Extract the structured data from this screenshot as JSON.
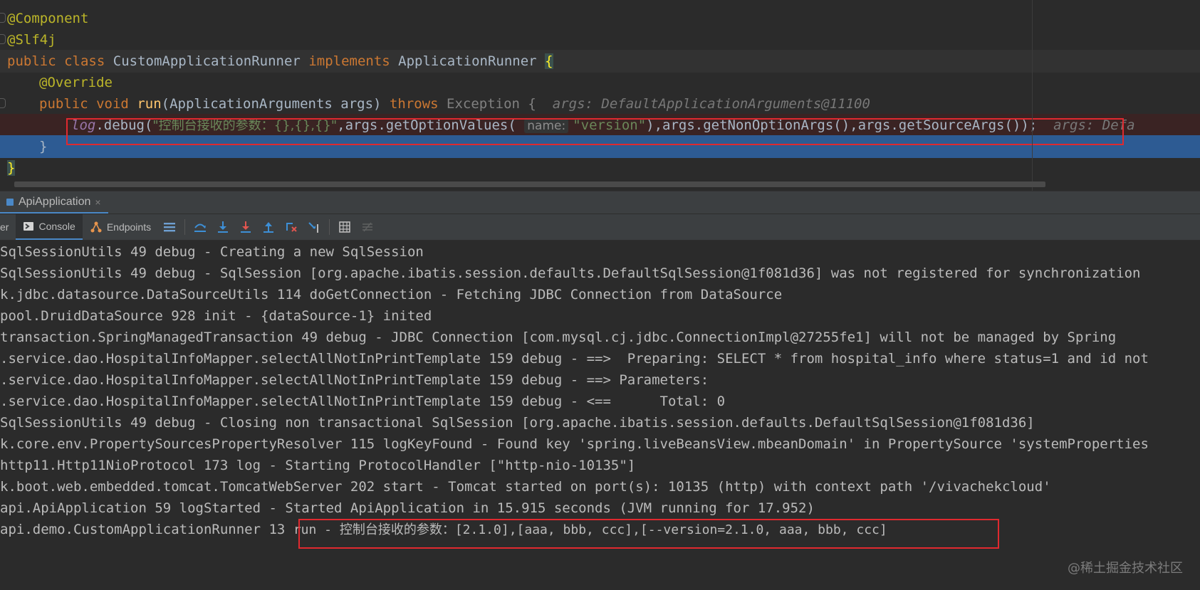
{
  "editor": {
    "line1": {
      "annotation": "@Component"
    },
    "line2": {
      "annotation": "@Slf4j"
    },
    "line3": {
      "kw_public": "public",
      "kw_class": "class",
      "class_name": "CustomApplicationRunner",
      "kw_implements": "implements",
      "interface_name": "ApplicationRunner",
      "brace": "{"
    },
    "line4": {
      "annotation": "@Override"
    },
    "line5": {
      "kw_public": "public",
      "kw_void": "void",
      "method": "run",
      "params": "(ApplicationArguments args)",
      "kw_throws": "throws",
      "exception": "Exception {",
      "hint": "args: DefaultApplicationArguments@11100"
    },
    "line6": {
      "field": "log",
      "call": ".debug(",
      "string": "\"控制台接收的参数：{},{},{}\"",
      "part1": ",args.getOptionValues(",
      "param_hint": "name:",
      "arg": "\"version\"",
      "part2": "),args.getNonOptionArgs(),args.getSourceArgs());",
      "hint": "args: Defa"
    },
    "line7": {
      "brace": "}"
    },
    "line8": {
      "brace": "}"
    }
  },
  "run_panel": {
    "tab_title": "ApiApplication",
    "tab_close": "×",
    "toolbar": {
      "truncated_tab": "er",
      "console_label": "Console",
      "endpoints_label": "Endpoints"
    }
  },
  "console": {
    "lines": [
      "SqlSessionUtils 49 debug - Creating a new SqlSession",
      "SqlSessionUtils 49 debug - SqlSession [org.apache.ibatis.session.defaults.DefaultSqlSession@1f081d36] was not registered for synchronization",
      "k.jdbc.datasource.DataSourceUtils 114 doGetConnection - Fetching JDBC Connection from DataSource",
      "pool.DruidDataSource 928 init - {dataSource-1} inited",
      "transaction.SpringManagedTransaction 49 debug - JDBC Connection [com.mysql.cj.jdbc.ConnectionImpl@27255fe1] will not be managed by Spring",
      ".service.dao.HospitalInfoMapper.selectAllNotInPrintTemplate 159 debug - ==>  Preparing: SELECT * from hospital_info where status=1 and id not",
      ".service.dao.HospitalInfoMapper.selectAllNotInPrintTemplate 159 debug - ==> Parameters: ",
      ".service.dao.HospitalInfoMapper.selectAllNotInPrintTemplate 159 debug - <==      Total: 0",
      "SqlSessionUtils 49 debug - Closing non transactional SqlSession [org.apache.ibatis.session.defaults.DefaultSqlSession@1f081d36]",
      "k.core.env.PropertySourcesPropertyResolver 115 logKeyFound - Found key 'spring.liveBeansView.mbeanDomain' in PropertySource 'systemProperties",
      "http11.Http11NioProtocol 173 log - Starting ProtocolHandler [\"http-nio-10135\"]",
      "k.boot.web.embedded.tomcat.TomcatWebServer 202 start - Tomcat started on port(s): 10135 (http) with context path '/vivachekcloud'",
      "api.ApiApplication 59 logStarted - Started ApiApplication in 15.915 seconds (JVM running for 17.952)"
    ],
    "last_line_prefix": "api.demo.CustomApplicationRunner 13 ",
    "last_line_prefix_pre": "api.demo.CustomApplicationRunner 13",
    "last_line_highlight": "run - 控制台接收的参数：[2.1.0],[aaa, bbb, ccc],[--version=2.1.0, aaa, bbb, ccc]"
  },
  "watermark": "@稀土掘金技术社区",
  "colors": {
    "highlight_box": "#e0292f",
    "exec_line": "#2d5b93",
    "accent_tab": "#4a88c7"
  }
}
